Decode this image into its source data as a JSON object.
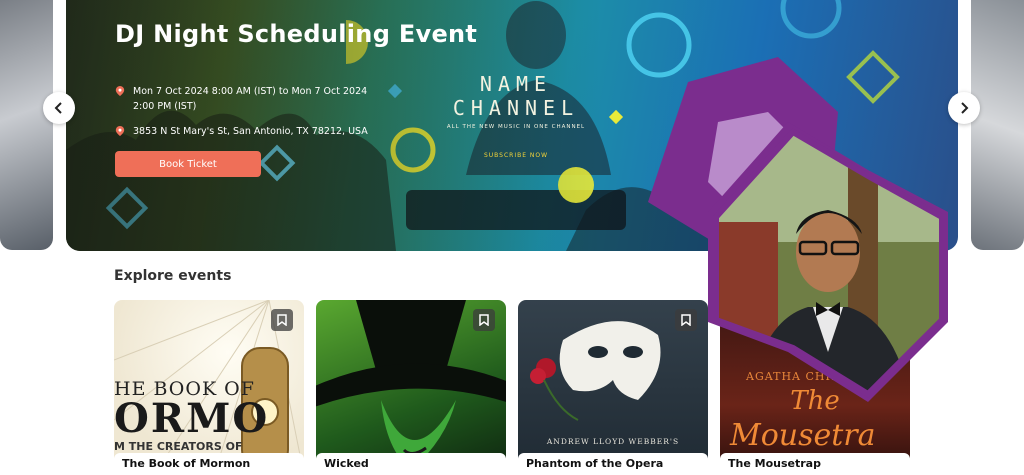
{
  "hero": {
    "title": "DJ Night Scheduling Event",
    "date_line_1": "Mon 7 Oct 2024 8:00 AM (IST) to Mon 7 Oct 2024",
    "date_line_2": "2:00 PM (IST)",
    "address": "3853 N St Mary's St, San Antonio, TX 78212, USA",
    "book_label": "Book Ticket",
    "poster": {
      "channel_name": "NAME CHANNEL",
      "channel_tagline": "ALL THE NEW MUSIC IN ONE CHANNEL",
      "channel_cta": "SUBSCRIBE NOW"
    }
  },
  "explore": {
    "title": "Explore events",
    "events": [
      {
        "name": "The Book of Mormon",
        "poster_lines": [
          "HE BOOK OF",
          "ORMO",
          "M THE CREATORS OF"
        ]
      },
      {
        "name": "Wicked"
      },
      {
        "name": "Phantom of the Opera",
        "poster_credit": "ANDREW LLOYD WEBBER'S"
      },
      {
        "name": "The Mousetrap",
        "poster_lines": [
          "AGATHA CHRISTIE'S",
          "The",
          "Mousetra"
        ]
      }
    ]
  },
  "icons": {
    "prev": "chevron-left-icon",
    "next": "chevron-right-icon",
    "location": "location-pin-icon",
    "bookmark": "bookmark-icon"
  },
  "colors": {
    "accent": "#ef6f58",
    "hexagon": "#7b2d8e"
  }
}
